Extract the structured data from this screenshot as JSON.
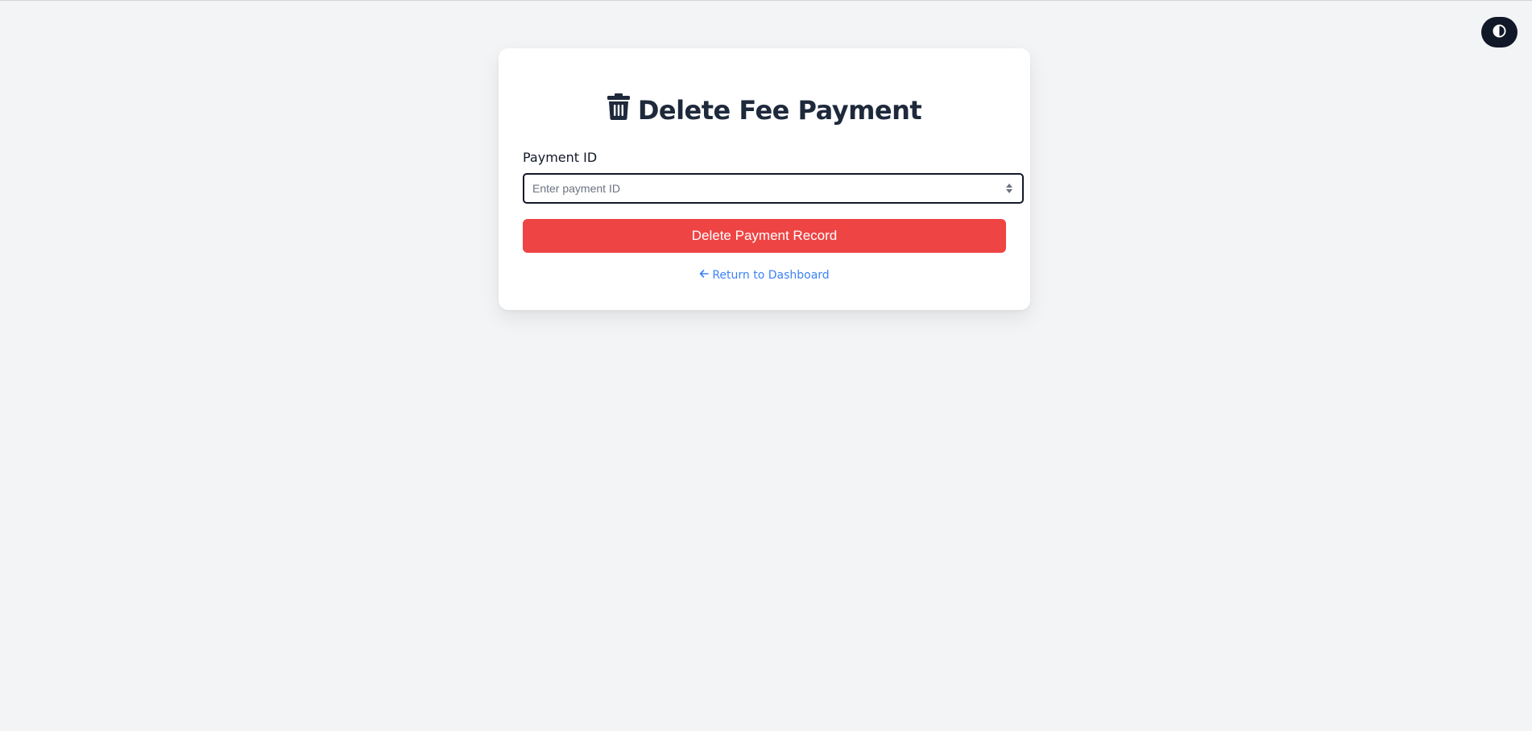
{
  "theme_toggle": {
    "icon": "half-circle-contrast-icon"
  },
  "card": {
    "title": "Delete Fee Payment",
    "title_icon": "trash-icon",
    "field_label": "Payment ID",
    "input": {
      "placeholder": "Enter payment ID",
      "value": ""
    },
    "submit_label": "Delete Payment Record",
    "return_link": {
      "icon": "arrow-left-icon",
      "label": "Return to Dashboard"
    }
  },
  "colors": {
    "page_bg": "#f3f4f6",
    "card_bg": "#ffffff",
    "title": "#1e293b",
    "danger": "#ef4444",
    "link": "#3b82f6",
    "toggle_bg": "#111827"
  }
}
